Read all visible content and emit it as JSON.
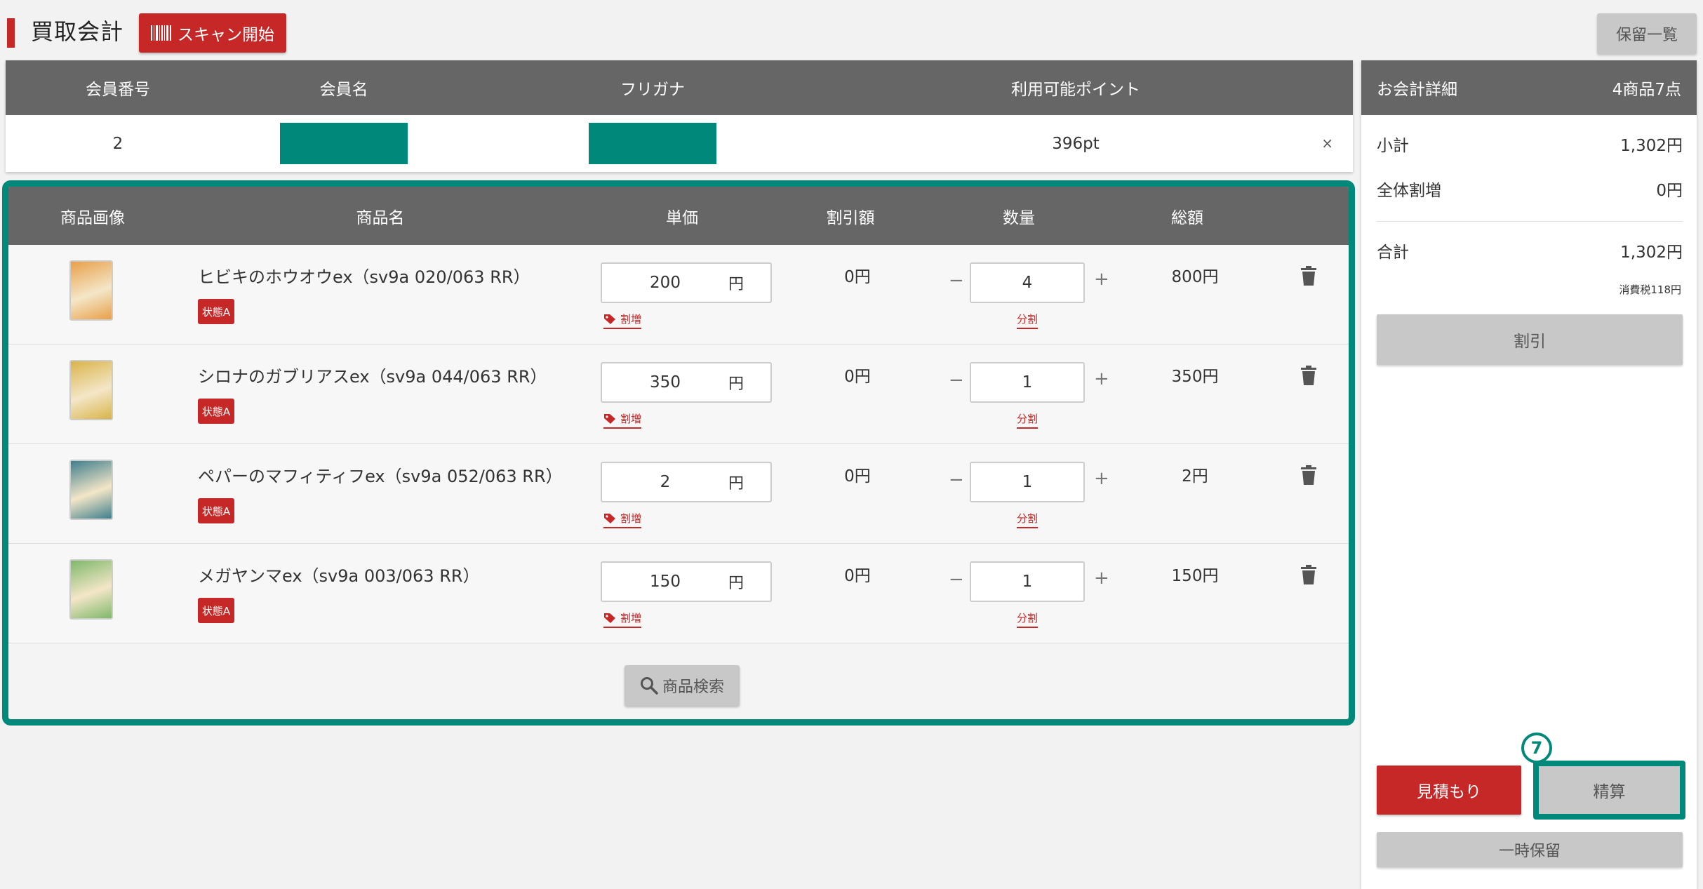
{
  "header": {
    "title": "買取会計",
    "scan_button": "スキャン開始",
    "hold_list_button": "保留一覧"
  },
  "member": {
    "columns": {
      "member_no": "会員番号",
      "member_name": "会員名",
      "kana": "フリガナ",
      "points": "利用可能ポイント"
    },
    "values": {
      "member_no": "2",
      "points": "396pt"
    },
    "close_label": "×"
  },
  "items_table": {
    "columns": {
      "image": "商品画像",
      "name": "商品名",
      "unit_price": "単価",
      "discount": "割引額",
      "quantity": "数量",
      "total": "総額"
    },
    "rows": [
      {
        "name": "ヒビキのホウオウex（sv9a 020/063 RR）",
        "condition": "状態A",
        "unit_price": "200",
        "currency": "円",
        "surcharge_link": "割増",
        "discount": "0円",
        "quantity": "4",
        "split_link": "分割",
        "total": "800円",
        "thumb_color": "#e8a04a"
      },
      {
        "name": "シロナのガブリアスex（sv9a 044/063 RR）",
        "condition": "状態A",
        "unit_price": "350",
        "currency": "円",
        "surcharge_link": "割増",
        "discount": "0円",
        "quantity": "1",
        "split_link": "分割",
        "total": "350円",
        "thumb_color": "#d9b44a"
      },
      {
        "name": "ペパーのマフィティフex（sv9a 052/063 RR）",
        "condition": "状態A",
        "unit_price": "2",
        "currency": "円",
        "surcharge_link": "割増",
        "discount": "0円",
        "quantity": "1",
        "split_link": "分割",
        "total": "2円",
        "thumb_color": "#3f7f8c"
      },
      {
        "name": "メガヤンマex（sv9a 003/063 RR）",
        "condition": "状態A",
        "unit_price": "150",
        "currency": "円",
        "surcharge_link": "割増",
        "discount": "0円",
        "quantity": "1",
        "split_link": "分割",
        "total": "150円",
        "thumb_color": "#7fb86a"
      }
    ],
    "search_button": "商品検索"
  },
  "summary": {
    "title": "お会計詳細",
    "item_count": "4商品7点",
    "subtotal_label": "小計",
    "subtotal_value": "1,302円",
    "overall_surcharge_label": "全体割増",
    "overall_surcharge_value": "0円",
    "total_label": "合計",
    "total_value": "1,302円",
    "tax_note": "消費税118円",
    "discount_button": "割引",
    "estimate_button": "見積もり",
    "checkout_button": "精算",
    "step_marker": "7",
    "hold_button": "一時保留"
  },
  "colors": {
    "brand_red": "#c62828",
    "highlight_teal": "#00897b",
    "header_gray": "#666666",
    "disabled_gray": "#c8c8c8"
  },
  "icons": [
    "barcode-icon",
    "tag-icon",
    "trash-icon",
    "search-icon"
  ]
}
